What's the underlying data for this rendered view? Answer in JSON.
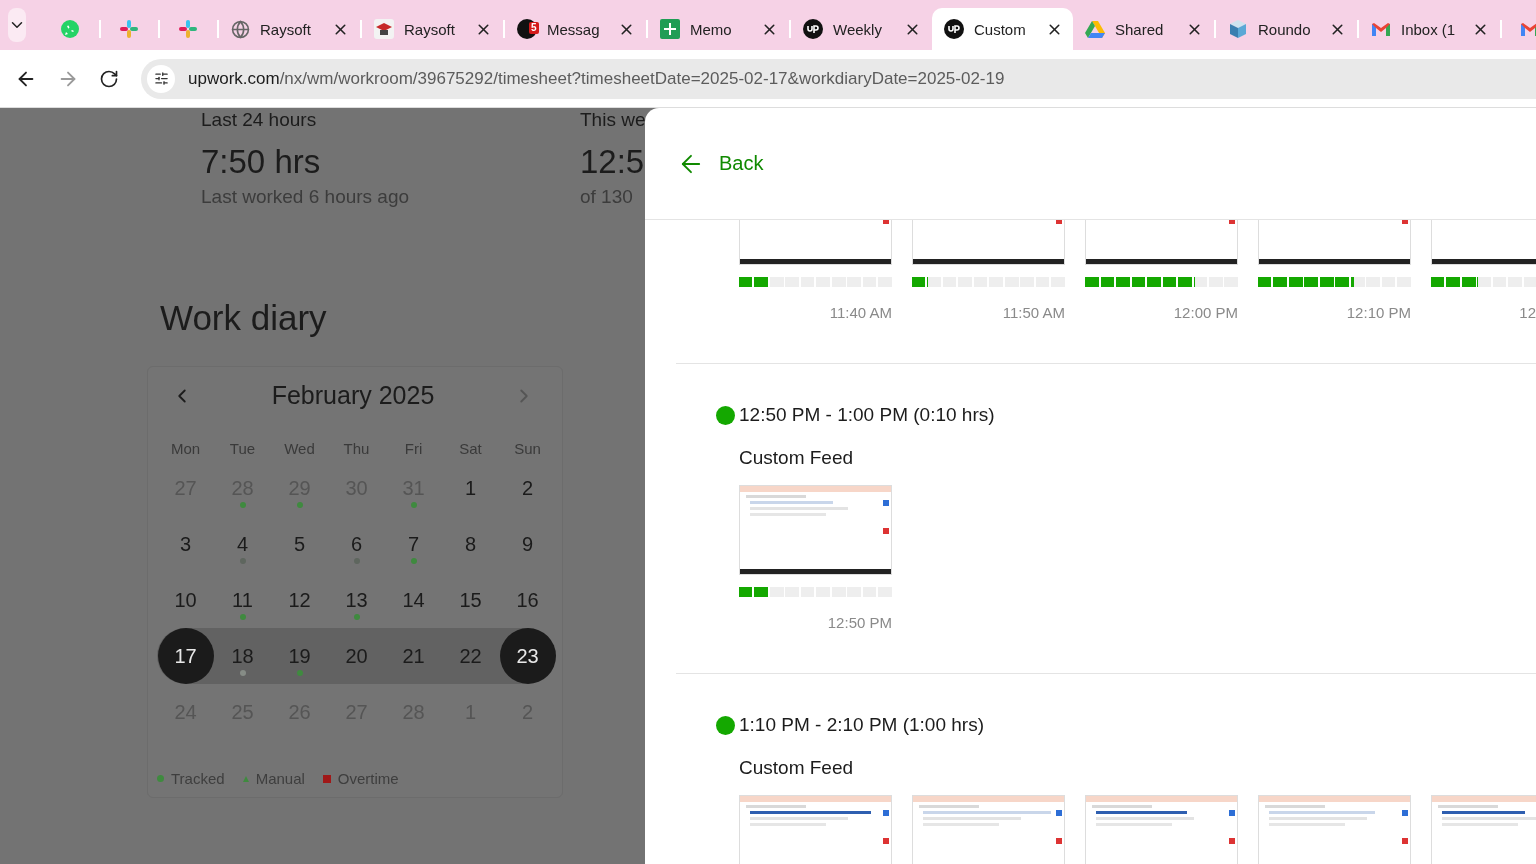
{
  "browser": {
    "tabs": [
      {
        "selected": false
      },
      {
        "selected": false
      },
      {
        "selected": false
      },
      {
        "title": "Raysoft",
        "selected": false
      },
      {
        "title": "Raysoft",
        "selected": false
      },
      {
        "title": "Messag",
        "badge": "5",
        "selected": false
      },
      {
        "title": "Memo",
        "selected": false
      },
      {
        "title": "Weekly",
        "selected": false
      },
      {
        "title": "Custom",
        "selected": true
      },
      {
        "title": "Shared",
        "selected": false
      },
      {
        "title": "Roundo",
        "selected": false
      },
      {
        "title": "Inbox (1",
        "selected": false
      },
      {
        "selected": false
      }
    ],
    "url": {
      "host": "upwork.com",
      "path": "/nx/wm/workroom/39675292/timesheet?timesheetDate=2025-02-17&workdiaryDate=2025-02-19"
    }
  },
  "stats": [
    {
      "label": "Last 24 hours",
      "value": "7:50 hrs",
      "note": "Last worked 6 hours ago"
    },
    {
      "label": "This we",
      "value": "12:5",
      "note": "of 130"
    }
  ],
  "work_diary": {
    "title": "Work diary",
    "month": "February  2025",
    "weekdays": [
      "Mon",
      "Tue",
      "Wed",
      "Thu",
      "Fri",
      "Sat",
      "Sun"
    ],
    "weeks": [
      {
        "highlighted": false,
        "days": [
          {
            "day": "27",
            "muted": true,
            "selected": false
          },
          {
            "day": "28",
            "muted": true,
            "selected": false,
            "color": "#3f8a3f"
          },
          {
            "day": "29",
            "muted": true,
            "selected": false,
            "color": "#3f8a3f"
          },
          {
            "day": "30",
            "muted": true,
            "selected": false
          },
          {
            "day": "31",
            "muted": true,
            "selected": false,
            "color": "#3f8a3f"
          },
          {
            "day": "1",
            "muted": false,
            "selected": false
          },
          {
            "day": "2",
            "muted": false,
            "selected": false
          }
        ]
      },
      {
        "highlighted": false,
        "days": [
          {
            "day": "3",
            "muted": false,
            "selected": false
          },
          {
            "day": "4",
            "muted": false,
            "selected": false,
            "color": "#5e665e"
          },
          {
            "day": "5",
            "muted": false,
            "selected": false
          },
          {
            "day": "6",
            "muted": false,
            "selected": false,
            "color": "#5e665e"
          },
          {
            "day": "7",
            "muted": false,
            "selected": false,
            "color": "#3f8a3f"
          },
          {
            "day": "8",
            "muted": false,
            "selected": false
          },
          {
            "day": "9",
            "muted": false,
            "selected": false
          }
        ]
      },
      {
        "highlighted": false,
        "days": [
          {
            "day": "10",
            "muted": false,
            "selected": false
          },
          {
            "day": "11",
            "muted": false,
            "selected": false,
            "color": "#3f8a3f"
          },
          {
            "day": "12",
            "muted": false,
            "selected": false
          },
          {
            "day": "13",
            "muted": false,
            "selected": false,
            "color": "#3f8a3f"
          },
          {
            "day": "14",
            "muted": false,
            "selected": false
          },
          {
            "day": "15",
            "muted": false,
            "selected": false
          },
          {
            "day": "16",
            "muted": false,
            "selected": false
          }
        ]
      },
      {
        "highlighted": true,
        "days": [
          {
            "day": "17",
            "muted": false,
            "selected": true
          },
          {
            "day": "18",
            "muted": false,
            "selected": false,
            "color": "#868c86"
          },
          {
            "day": "19",
            "muted": false,
            "selected": false,
            "color": "#3f8a3f"
          },
          {
            "day": "20",
            "muted": false,
            "selected": false
          },
          {
            "day": "21",
            "muted": false,
            "selected": false
          },
          {
            "day": "22",
            "muted": false,
            "selected": false
          },
          {
            "day": "23",
            "muted": false,
            "selected": true
          }
        ]
      },
      {
        "highlighted": false,
        "days": [
          {
            "day": "24",
            "muted": true,
            "selected": false
          },
          {
            "day": "25",
            "muted": true,
            "selected": false
          },
          {
            "day": "26",
            "muted": true,
            "selected": false
          },
          {
            "day": "27",
            "muted": true,
            "selected": false
          },
          {
            "day": "28",
            "muted": true,
            "selected": false
          },
          {
            "day": "1",
            "muted": true,
            "selected": false
          },
          {
            "day": "2",
            "muted": true,
            "selected": false
          }
        ]
      }
    ],
    "legend": [
      {
        "kind": "dot",
        "label": "Tracked",
        "color": "#3f8a3f"
      },
      {
        "kind": "triangle",
        "label": "Manual",
        "color": "#3f8a3f"
      },
      {
        "kind": "square",
        "label": "Overtime",
        "color": "#a01818"
      }
    ]
  },
  "panel": {
    "back": "Back",
    "sections": [
      {
        "thumbnails": [
          {
            "kind": "screenshot",
            "level": 0.2,
            "time": "11:40 AM"
          },
          {
            "kind": "screenshot",
            "level": 0.1,
            "time": "11:50 AM"
          },
          {
            "kind": "screenshot",
            "level": 0.71,
            "time": "12:00 PM"
          },
          {
            "kind": "screenshot",
            "level": 0.62,
            "time": "12:10 PM"
          },
          {
            "kind": "screenshot",
            "level": 0.3,
            "time": "12"
          }
        ]
      },
      {
        "range": "12:50 PM - 1:00 PM (0:10 hrs)",
        "memo": "Custom Feed",
        "thumbnails": [
          {
            "kind": "screenshot",
            "level": 0.2,
            "time": "12:50 PM"
          }
        ]
      },
      {
        "range": "1:10 PM - 2:10 PM (1:00 hrs)",
        "memo": "Custom Feed",
        "thumbnails": [
          {
            "kind": "screenshot"
          },
          {
            "kind": "screenshot"
          },
          {
            "kind": "screenshot"
          },
          {
            "kind": "screenshot"
          },
          {
            "kind": "screenshot"
          }
        ]
      }
    ]
  }
}
